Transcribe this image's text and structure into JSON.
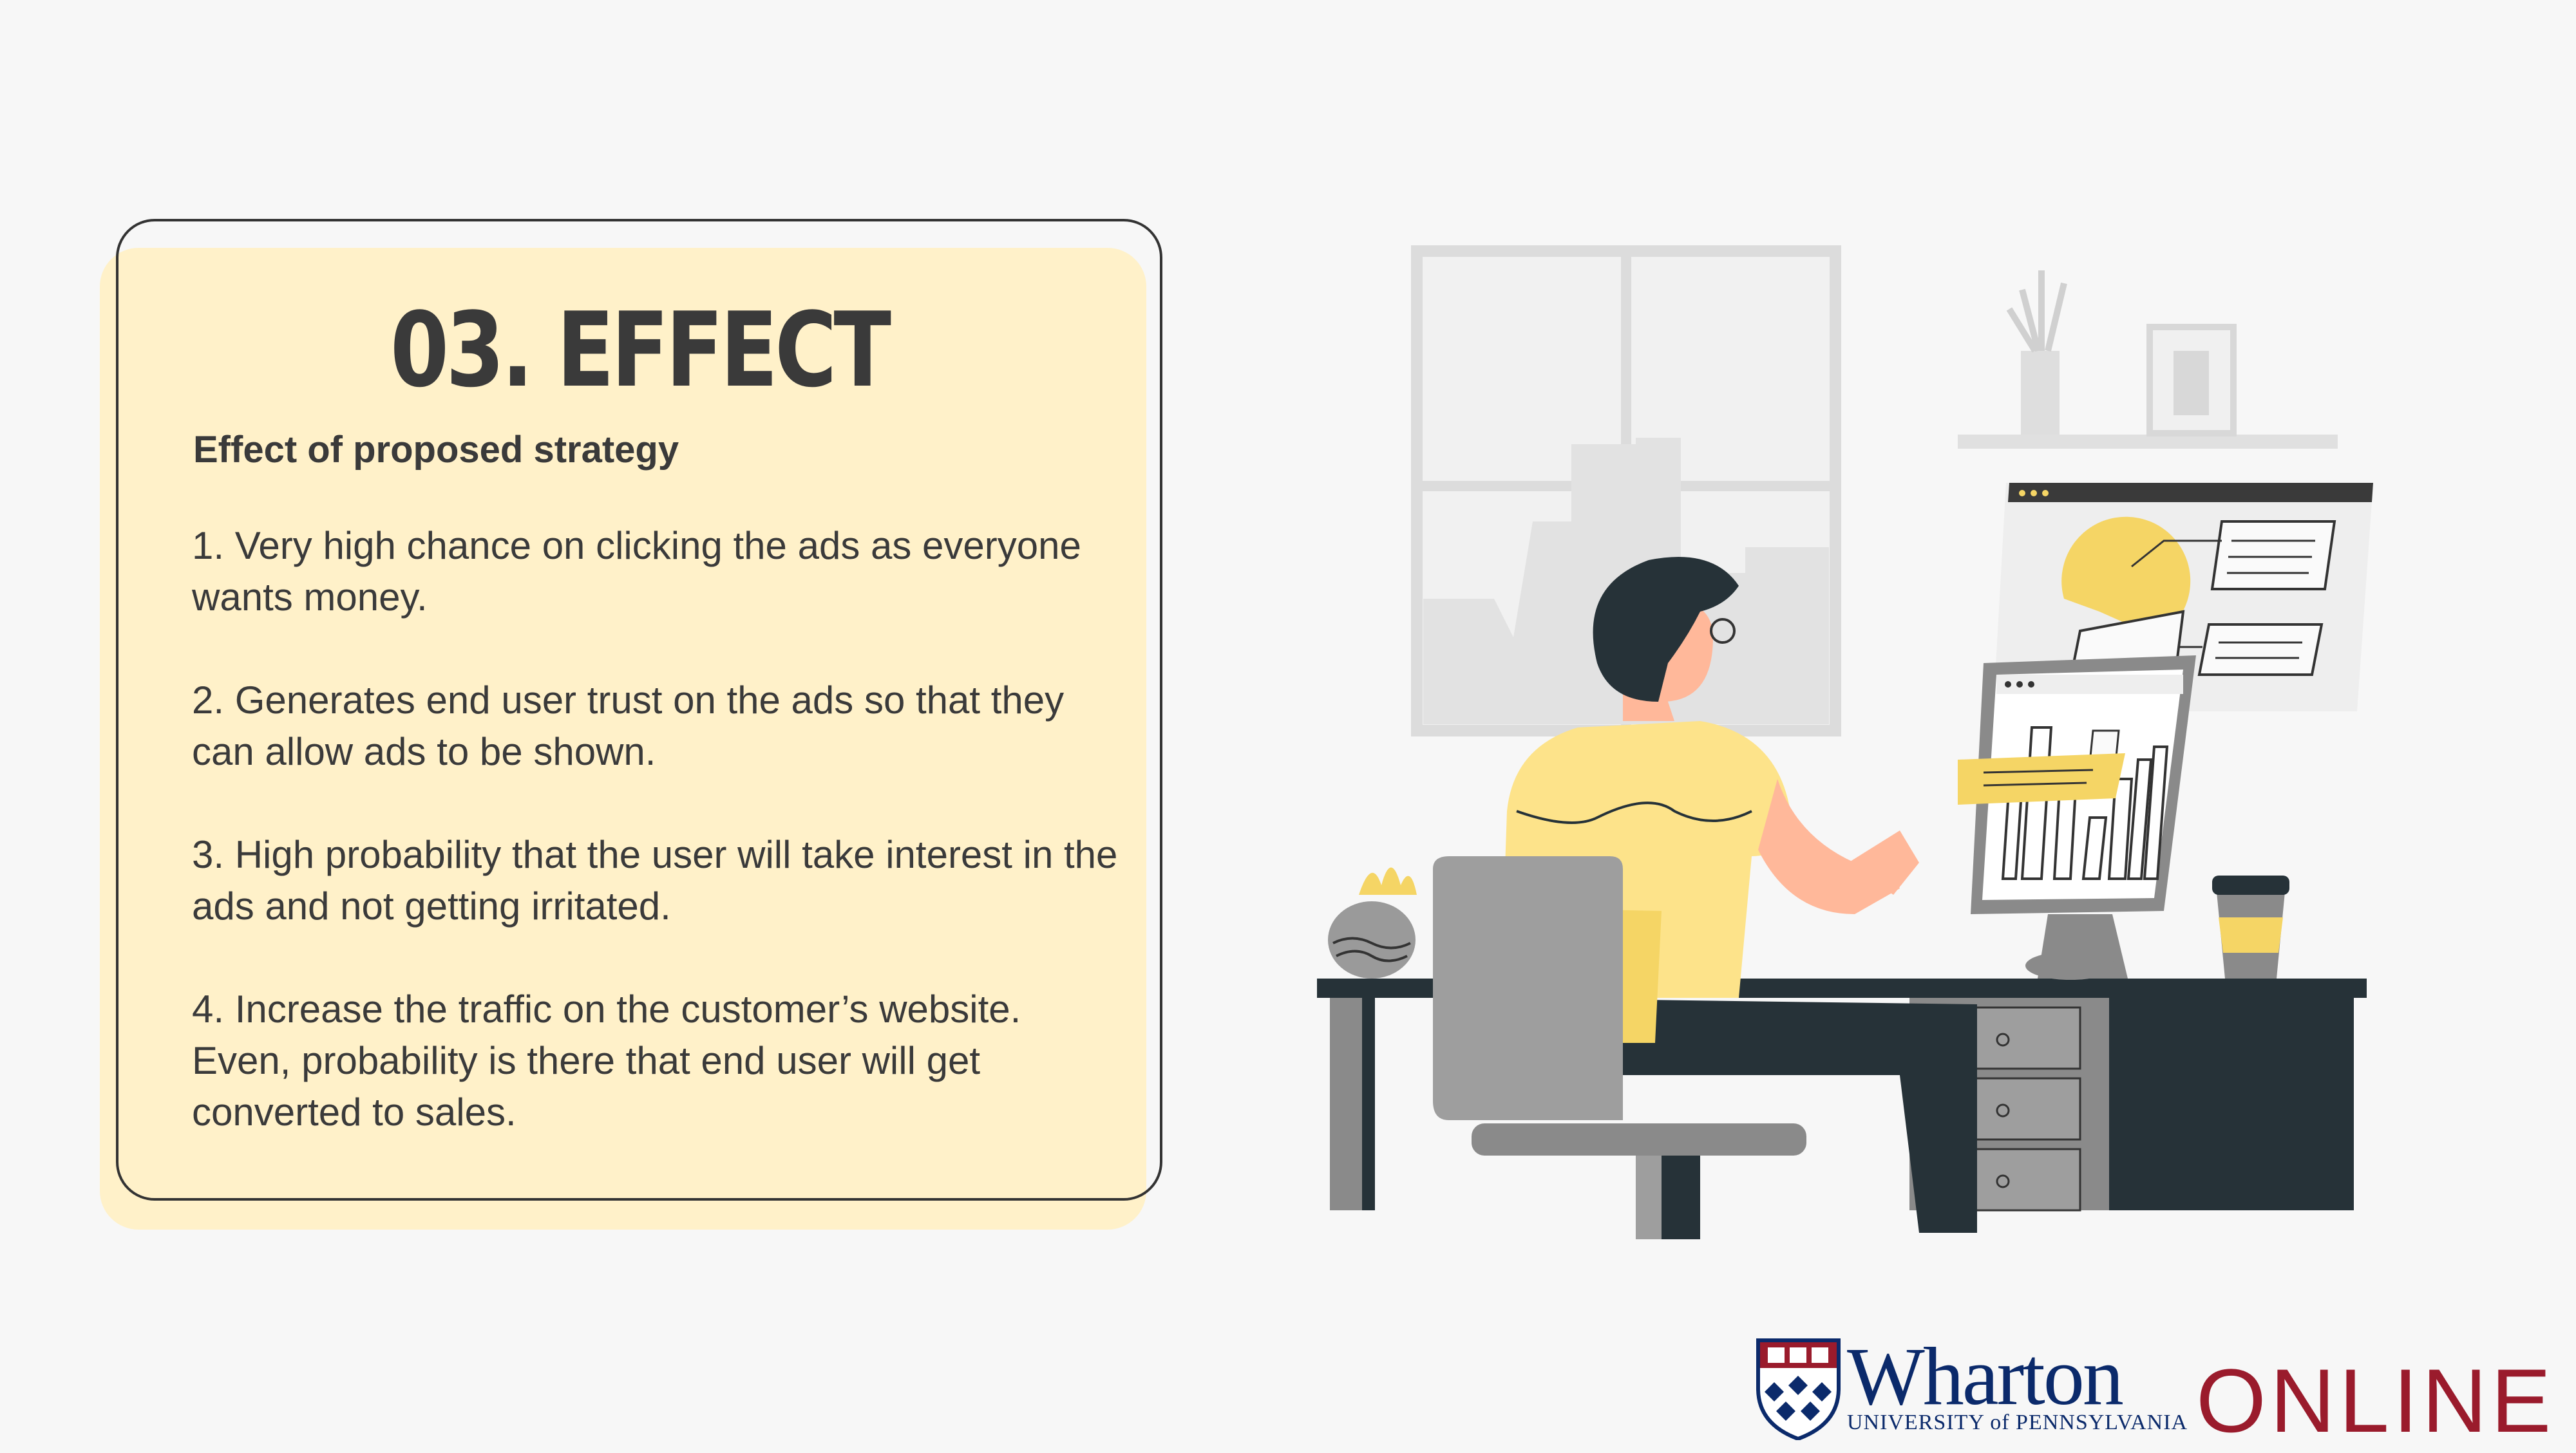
{
  "slide": {
    "title": "03. EFFECT",
    "subtitle": "Effect of proposed strategy",
    "points": [
      "1. Very high chance on clicking the ads as everyone wants money.",
      "2. Generates end user trust on the ads so that they can allow ads to be shown.",
      "3. High probability that the user will take interest in the ads and not getting irritated.",
      "4. Increase the traffic on the customer’s website. Even, probability is there that end user will get converted to sales."
    ]
  },
  "illustration": {
    "icon": "person-at-computer-illustration"
  },
  "branding": {
    "wharton": "Wharton",
    "university": "UNIVERSITY of PENNSYLVANIA",
    "online": "ONLINE",
    "navy": "#0b2a6b",
    "crimson": "#9a1b2c"
  },
  "colors": {
    "card_fill": "#fff1c9",
    "accent_yellow": "#f5d565",
    "text": "#3a3a3a",
    "desk": "#263238"
  }
}
